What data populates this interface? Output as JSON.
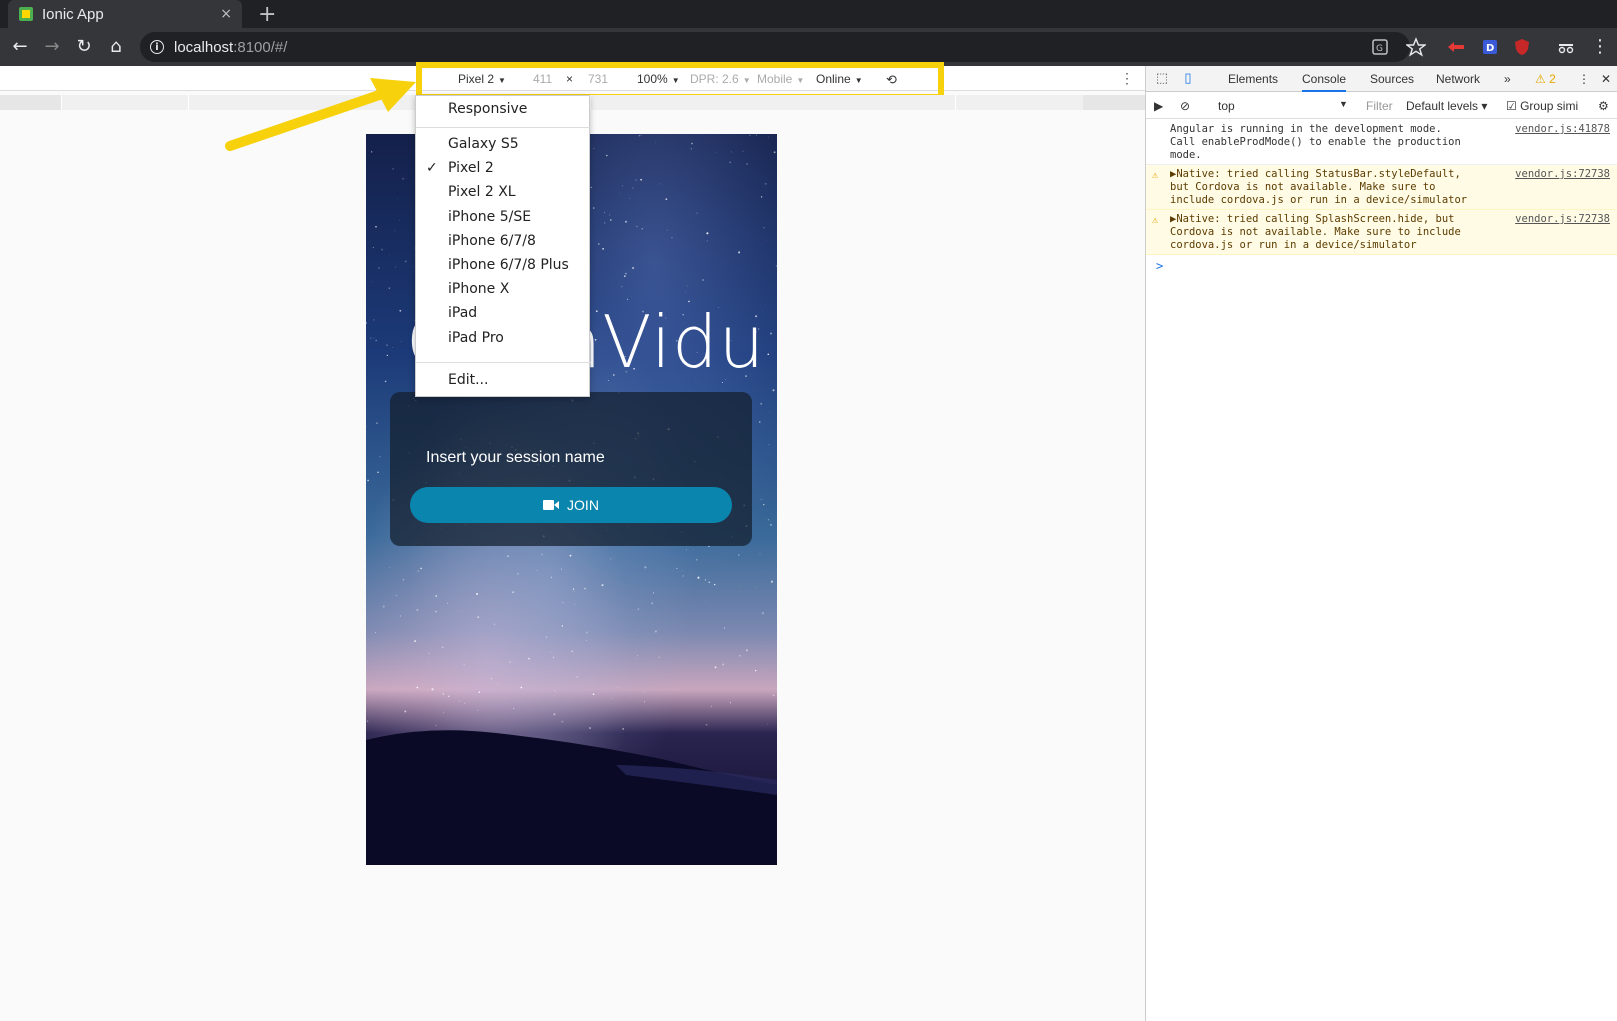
{
  "browser": {
    "tab_title": "Ionic App",
    "tab_close": "×",
    "new_tab": "+",
    "url_host": "localhost",
    "url_rest": ":8100/#/"
  },
  "device_toolbar": {
    "device": "Pixel 2",
    "width": "411",
    "times": "×",
    "height": "731",
    "zoom": "100%",
    "dpr": "DPR: 2.6",
    "mode": "Mobile",
    "network": "Online"
  },
  "device_menu": {
    "responsive": "Responsive",
    "items": [
      "Galaxy S5",
      "Pixel 2",
      "Pixel 2 XL",
      "iPhone 5/SE",
      "iPhone 6/7/8",
      "iPhone 6/7/8 Plus",
      "iPhone X",
      "iPad",
      "iPad Pro"
    ],
    "selected": "Pixel 2",
    "edit": "Edit..."
  },
  "app": {
    "logo_text": "OpenVidu",
    "session_label": "Insert your session name",
    "join_label": "JOIN"
  },
  "devtools": {
    "tabs": [
      "Elements",
      "Console",
      "Sources",
      "Network"
    ],
    "active_tab": "Console",
    "more_tabs": "»",
    "warning_count": "2",
    "context": "top",
    "filter_placeholder": "Filter",
    "levels": "Default levels",
    "group_similar": "Group simi",
    "messages": [
      {
        "type": "log",
        "text": "Angular is running in the development mode. Call enableProdMode() to enable the production mode.",
        "source": "vendor.js:41878"
      },
      {
        "type": "warn",
        "text": "▶Native: tried calling StatusBar.styleDefault, but Cordova is not available. Make sure to include cordova.js or run in a device/simulator",
        "source": "vendor.js:72738"
      },
      {
        "type": "warn",
        "text": "▶Native: tried calling SplashScreen.hide, but Cordova is not available. Make sure to include cordova.js or run in a device/simulator",
        "source": "vendor.js:72738"
      }
    ],
    "prompt": ">"
  },
  "colors": {
    "highlight": "#f7d10c",
    "join_button": "#0a86ae",
    "devtools_accent": "#1a73e8"
  }
}
